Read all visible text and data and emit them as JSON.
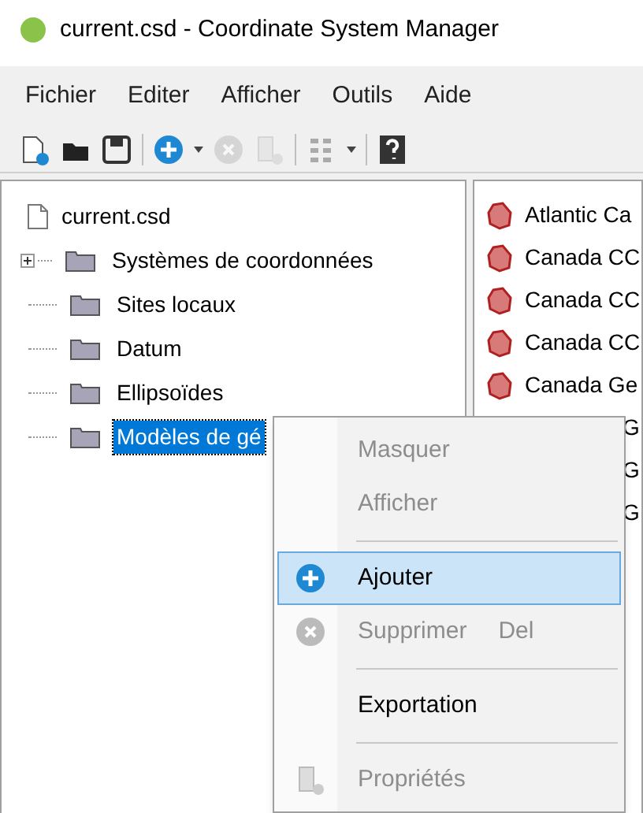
{
  "window": {
    "title": "current.csd - Coordinate System Manager"
  },
  "menu_bar": [
    "Fichier",
    "Editer",
    "Afficher",
    "Outils",
    "Aide"
  ],
  "toolbar": [
    {
      "kind": "new",
      "disabled": false
    },
    {
      "kind": "open",
      "disabled": false
    },
    {
      "kind": "save",
      "disabled": false
    },
    {
      "kind": "sep"
    },
    {
      "kind": "add",
      "disabled": false,
      "dropdown": true
    },
    {
      "kind": "delete",
      "disabled": true
    },
    {
      "kind": "properties",
      "disabled": true
    },
    {
      "kind": "sep"
    },
    {
      "kind": "grid",
      "disabled": false,
      "dropdown": true
    },
    {
      "kind": "sep"
    },
    {
      "kind": "help",
      "disabled": false
    }
  ],
  "tree": {
    "root": "current.csd",
    "children": [
      {
        "label": "Systèmes de coordonnées",
        "expandable": true,
        "selected": false
      },
      {
        "label": "Sites locaux",
        "expandable": false,
        "selected": false
      },
      {
        "label": "Datum",
        "expandable": false,
        "selected": false
      },
      {
        "label": "Ellipsoïdes",
        "expandable": false,
        "selected": false
      },
      {
        "label": "Modèles de gé",
        "expandable": false,
        "selected": true
      }
    ]
  },
  "list": [
    {
      "label": "Atlantic Ca",
      "kind": "full"
    },
    {
      "label": "Canada CC",
      "kind": "full"
    },
    {
      "label": "Canada CC",
      "kind": "full"
    },
    {
      "label": "Canada CC",
      "kind": "full"
    },
    {
      "label": "Canada Ge",
      "kind": "full"
    },
    {
      "label": "G",
      "kind": "partial"
    },
    {
      "label": "G",
      "kind": "partial"
    },
    {
      "label": "G",
      "kind": "partial"
    }
  ],
  "context_menu": [
    {
      "kind": "plain",
      "label": "Masquer",
      "disabled": true,
      "selected": false
    },
    {
      "kind": "plain",
      "label": "Afficher",
      "disabled": true,
      "selected": false
    },
    {
      "kind": "sep"
    },
    {
      "kind": "add",
      "label": "Ajouter",
      "disabled": false,
      "selected": true
    },
    {
      "kind": "delete",
      "label": "Supprimer",
      "shortcut": "Del",
      "disabled": true,
      "selected": false
    },
    {
      "kind": "sep"
    },
    {
      "kind": "plain",
      "label": "Exportation",
      "disabled": false,
      "selected": false
    },
    {
      "kind": "sep"
    },
    {
      "kind": "properties",
      "label": "Propriétés",
      "disabled": true,
      "selected": false
    }
  ]
}
